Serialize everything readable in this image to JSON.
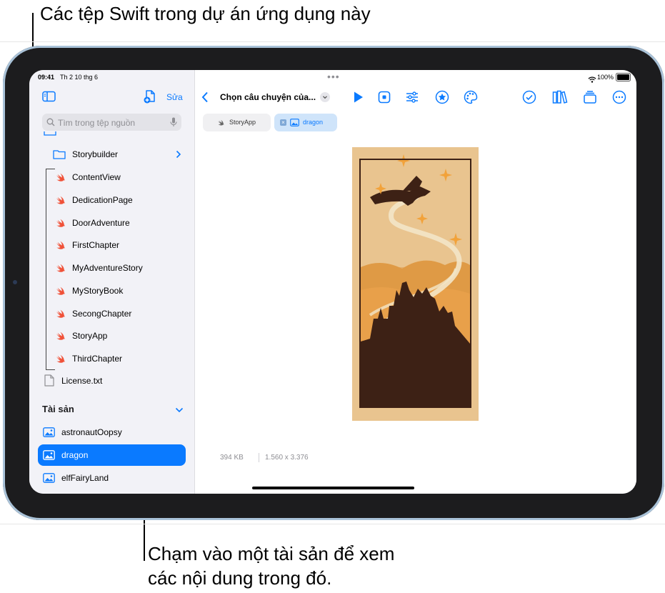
{
  "callouts": {
    "top": "Các tệp Swift trong dự án ứng dụng này",
    "bottom_line1": "Chạm vào một tài sản để xem",
    "bottom_line2": "các nội dung trong đó."
  },
  "status_bar": {
    "time": "09:41",
    "date": "Th 2 10 thg 6",
    "battery": "100%"
  },
  "sidebar": {
    "edit_label": "Sửa",
    "search_placeholder": "Tìm trong tệp nguồn",
    "folder": "Storybuilder",
    "files": [
      "ContentView",
      "DedicationPage",
      "DoorAdventure",
      "FirstChapter",
      "MyAdventureStory",
      "MyStoryBook",
      "SecongChapter",
      "StoryApp",
      "ThirdChapter"
    ],
    "license": "License.txt",
    "assets_header": "Tài sản",
    "assets": [
      "astronautOopsy",
      "dragon",
      "elfFairyLand"
    ],
    "selected_asset": "dragon"
  },
  "toolbar": {
    "title": "Chọn câu chuyện của..."
  },
  "tabs": [
    "StoryApp",
    "dragon"
  ],
  "image_info": {
    "size": "394 KB",
    "dimensions": "1.560 x 3.376"
  },
  "colors": {
    "accent": "#0a7aff",
    "swift": "#f05138",
    "poster_bg": "#e8c08a",
    "poster_dark": "#3d2115"
  }
}
